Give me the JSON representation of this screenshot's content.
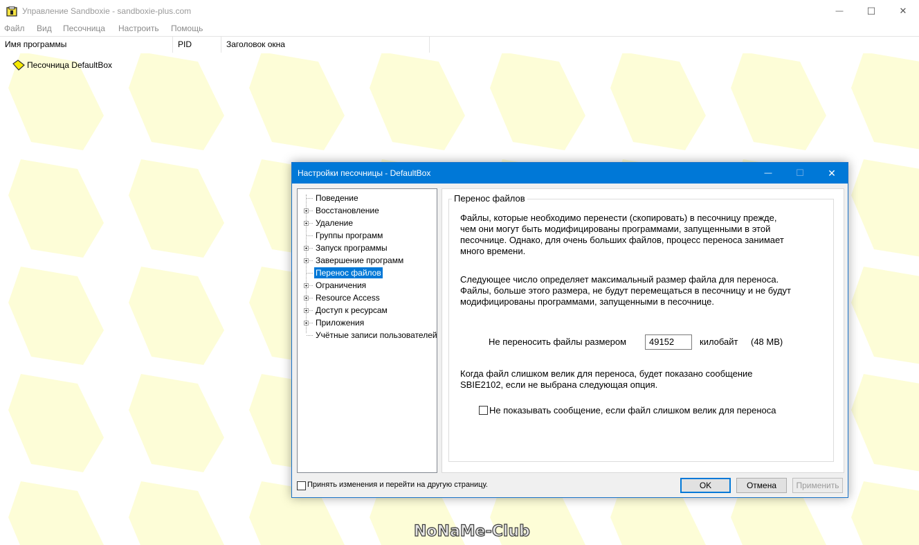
{
  "window": {
    "title": "Управление Sandboxie - sandboxie-plus.com",
    "menu": [
      "Файл",
      "Вид",
      "Песочница",
      "Настроить",
      "Помощь"
    ],
    "columns": [
      "Имя программы",
      "PID",
      "Заголовок окна"
    ],
    "sandbox_row": "Песочница DefaultBox",
    "controls": {
      "minimize": "—",
      "maximize": "☐",
      "close": "✕"
    }
  },
  "dialog": {
    "title": "Настройки песочницы - DefaultBox",
    "controls": {
      "minimize": "—",
      "maximize": "☐",
      "close": "✕"
    },
    "tree": [
      {
        "label": "Поведение",
        "expandable": false
      },
      {
        "label": "Восстановление",
        "expandable": true
      },
      {
        "label": "Удаление",
        "expandable": true
      },
      {
        "label": "Группы программ",
        "expandable": false
      },
      {
        "label": "Запуск программы",
        "expandable": true
      },
      {
        "label": "Завершение программ",
        "expandable": true
      },
      {
        "label": "Перенос файлов",
        "expandable": false,
        "selected": true
      },
      {
        "label": "Ограничения",
        "expandable": true
      },
      {
        "label": "Resource Access",
        "expandable": true
      },
      {
        "label": "Доступ к ресурсам",
        "expandable": true
      },
      {
        "label": "Приложения",
        "expandable": true
      },
      {
        "label": "Учётные записи пользователей",
        "expandable": false
      }
    ],
    "page": {
      "group_title": "Перенос файлов",
      "para1": [
        "Файлы, которые необходимо перенести (скопировать) в песочницу прежде,",
        "чем они могут быть модифицированы программами, запущенными в этой",
        "песочнице.  Однако, для очень больших файлов, процесс переноса занимает",
        "много времени."
      ],
      "para2": [
        "Следующее число определяет максимальный размер файла для переноса.",
        "Файлы, больше этого размера, не будут перемещаться в песочницу и не будут",
        "модифицированы программами, запущенными в песочнице."
      ],
      "size_label": "Не переносить файлы размером",
      "size_value": "49152",
      "size_unit": "килобайт",
      "size_mb": "(48 MB)",
      "para3": [
        "Когда файл слишком велик для переноса, будет показано сообщение",
        "SBIE2102, если не выбрана следующая опция."
      ],
      "checkbox_label": "Не показывать сообщение, если файл слишком велик для переноса"
    },
    "footer": {
      "apply_and_go_label": "Принять изменения и перейти на другую страницу.",
      "ok": "OK",
      "cancel": "Отмена",
      "apply": "Применить"
    }
  },
  "watermark": "NoNaMe-Club",
  "colors": {
    "accent": "#0078d7",
    "sandbox_yellow": "#fdfdd7",
    "dialog_bg": "#f0f0f0"
  }
}
